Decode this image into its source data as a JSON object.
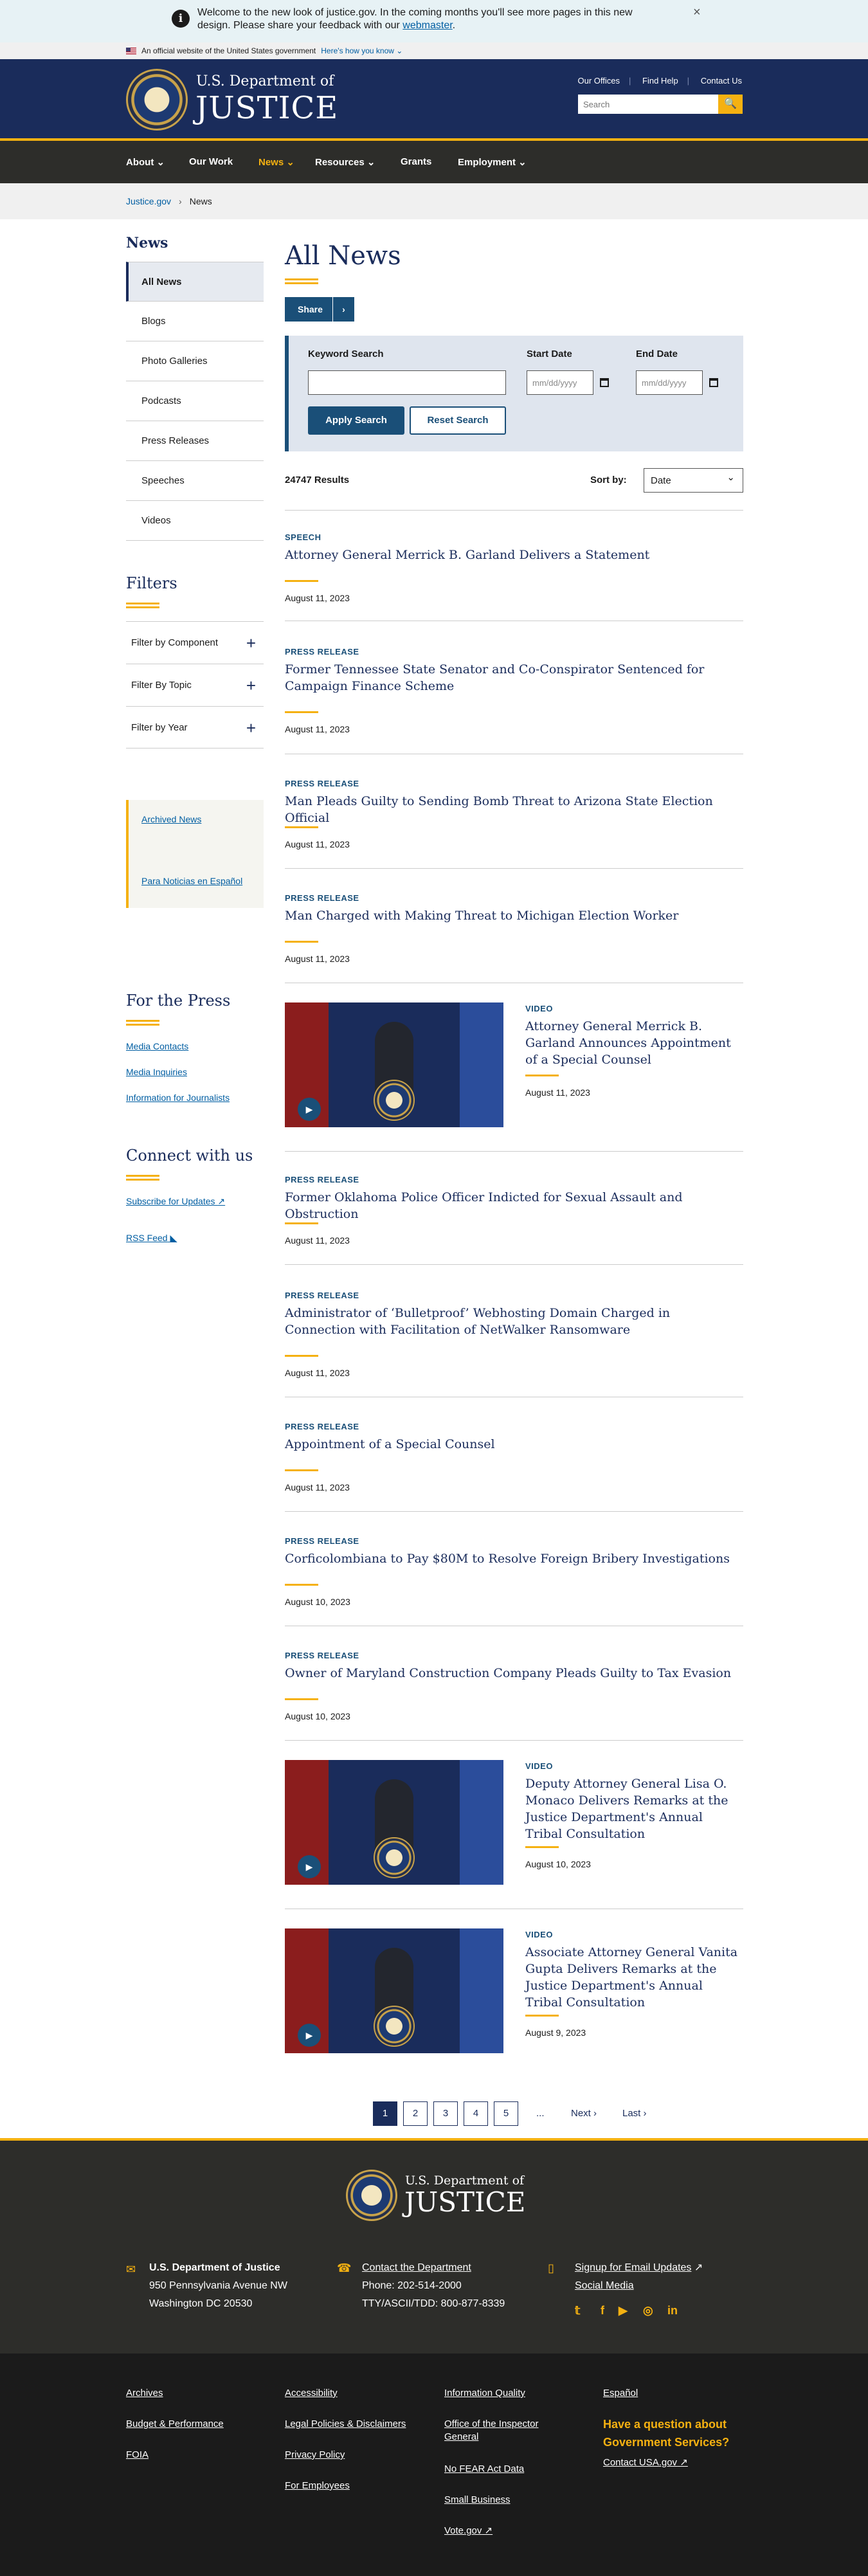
{
  "alert": {
    "text": "Welcome to the new look of justice.gov. In the coming months you'll see more pages in this new design. Please share your feedback with our ",
    "link": "webmaster",
    "end": "."
  },
  "banner": {
    "text": "An official website of the United States government",
    "link": "Here's how you know"
  },
  "header": {
    "dept": "U.S. Department of",
    "name": "JUSTICE",
    "links": [
      "Our Offices",
      "Find Help",
      "Contact Us"
    ],
    "search_placeholder": "Search"
  },
  "nav": [
    "About",
    "Our Work",
    "News",
    "Resources",
    "Grants",
    "Employment"
  ],
  "breadcrumb": {
    "home": "Justice.gov",
    "current": "News"
  },
  "sidebar": {
    "title": "News",
    "items": [
      "All News",
      "Blogs",
      "Photo Galleries",
      "Podcasts",
      "Press Releases",
      "Speeches",
      "Videos"
    ],
    "filters_title": "Filters",
    "filters": [
      "Filter by Component",
      "Filter By Topic",
      "Filter by Year"
    ],
    "archive": [
      "Archived News",
      "Para Noticias en Español"
    ],
    "press_title": "For the Press",
    "press_links": [
      "Media Contacts",
      "Media Inquiries",
      "Information for Journalists"
    ],
    "connect_title": "Connect with us",
    "connect_links": [
      "Subscribe for Updates",
      "RSS Feed"
    ]
  },
  "main": {
    "title": "All News",
    "share": "Share",
    "search": {
      "keyword_label": "Keyword Search",
      "start_label": "Start Date",
      "end_label": "End Date",
      "date_placeholder": "mm/dd/yyyy",
      "apply": "Apply Search",
      "reset": "Reset Search"
    },
    "results": "24747 Results",
    "sort_label": "Sort by:",
    "sort_value": "Date",
    "items": [
      {
        "cat": "SPEECH",
        "title": "Attorney General Merrick B. Garland Delivers a Statement",
        "date": "August 11, 2023"
      },
      {
        "cat": "PRESS RELEASE",
        "title": "Former Tennessee State Senator and Co-Conspirator Sentenced for Campaign Finance Scheme",
        "date": "August 11, 2023"
      },
      {
        "cat": "PRESS RELEASE",
        "title": "Man Pleads Guilty to Sending Bomb Threat to Arizona State Election Official",
        "date": "August 11, 2023"
      },
      {
        "cat": "PRESS RELEASE",
        "title": "Man Charged with Making Threat to Michigan Election Worker",
        "date": "August 11, 2023"
      },
      {
        "cat": "VIDEO",
        "title": "Attorney General Merrick B. Garland Announces Appointment of a Special Counsel",
        "date": "August 11, 2023"
      },
      {
        "cat": "PRESS RELEASE",
        "title": "Former Oklahoma Police Officer Indicted for Sexual Assault and Obstruction",
        "date": "August 11, 2023"
      },
      {
        "cat": "PRESS RELEASE",
        "title": "Administrator of ‘Bulletproof’ Webhosting Domain Charged in Connection with Facilitation of NetWalker Ransomware",
        "date": "August 11, 2023"
      },
      {
        "cat": "PRESS RELEASE",
        "title": "Appointment of a Special Counsel",
        "date": "August 11, 2023"
      },
      {
        "cat": "PRESS RELEASE",
        "title": "Corficolombiana to Pay $80M to Resolve Foreign Bribery Investigations",
        "date": "August 10, 2023"
      },
      {
        "cat": "PRESS RELEASE",
        "title": "Owner of Maryland Construction Company Pleads Guilty to Tax Evasion",
        "date": "August 10, 2023"
      },
      {
        "cat": "VIDEO",
        "title": "Deputy Attorney General Lisa O. Monaco Delivers Remarks at the Justice Department's Annual Tribal Consultation",
        "date": "August 10, 2023"
      },
      {
        "cat": "VIDEO",
        "title": "Associate Attorney General Vanita Gupta Delivers Remarks at the Justice Department's Annual Tribal Consultation",
        "date": "August 9, 2023"
      }
    ]
  },
  "pager": {
    "pages": [
      "1",
      "2",
      "3",
      "4",
      "5"
    ],
    "ellipsis": "...",
    "next": "Next",
    "last": "Last"
  },
  "footer": {
    "dept": "U.S. Department of",
    "name": "JUSTICE",
    "address": [
      "U.S. Department of Justice",
      "950 Pennsylvania Avenue NW",
      "Washington DC 20530"
    ],
    "contact": [
      "Contact the Department",
      "Phone: 202-514-2000",
      "TTY/ASCII/TDD: 800-877-8339"
    ],
    "signup": [
      "Signup for Email Updates",
      "Social Media"
    ],
    "col1": [
      "Archives",
      "Budget & Performance",
      "FOIA"
    ],
    "col2": [
      "Accessibility",
      "Legal Policies & Disclaimers",
      "Privacy Policy",
      "For Employees"
    ],
    "col3": [
      "Information Quality",
      "Office of the Inspector General",
      "No FEAR Act Data",
      "Small Business",
      "Vote.gov"
    ],
    "col4": [
      "Español"
    ],
    "question": "Have a question about Government Services?",
    "usa": "Contact USA.gov"
  }
}
